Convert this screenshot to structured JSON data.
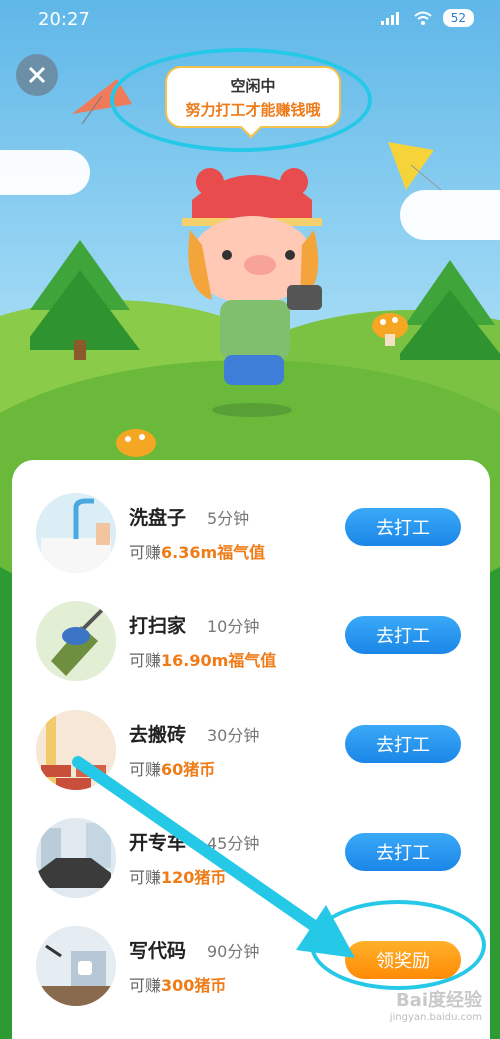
{
  "status_bar": {
    "time": "20:27",
    "battery": "52"
  },
  "bubble": {
    "line1": "空闲中",
    "line2": "努力打工才能赚钱哦"
  },
  "tasks": [
    {
      "title": "洗盘子",
      "duration": "5分钟",
      "earn_prefix": "可赚",
      "earn_value": "6.36m福气值",
      "button": "去打工",
      "avatar": "dishwashing-icon"
    },
    {
      "title": "打扫家",
      "duration": "10分钟",
      "earn_prefix": "可赚",
      "earn_value": "16.90m福气值",
      "button": "去打工",
      "avatar": "broom-icon"
    },
    {
      "title": "去搬砖",
      "duration": "30分钟",
      "earn_prefix": "可赚",
      "earn_value": "60猪币",
      "button": "去打工",
      "avatar": "bricks-icon"
    },
    {
      "title": "开专车",
      "duration": "45分钟",
      "earn_prefix": "可赚",
      "earn_value": "120猪币",
      "button": "去打工",
      "avatar": "car-icon"
    },
    {
      "title": "写代码",
      "duration": "90分钟",
      "earn_prefix": "可赚",
      "earn_value": "300猪币",
      "button": "领奖励",
      "avatar": "laptop-icon"
    }
  ],
  "watermark": {
    "brand": "Bai度经验",
    "url": "jingyan.baidu.com"
  },
  "colors": {
    "primary_button": "#1b86e8",
    "reward_button": "#ff8a05",
    "earn_value": "#f07c18",
    "highlight": "#25c8e6"
  }
}
